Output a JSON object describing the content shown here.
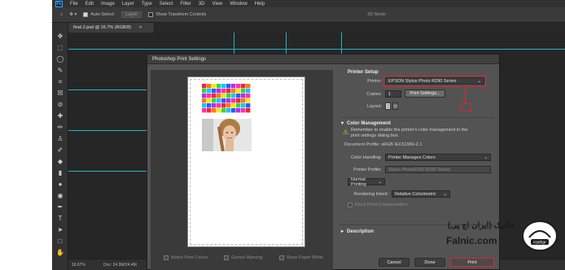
{
  "menubar": {
    "logo": "Ps",
    "items": [
      "File",
      "Edit",
      "Image",
      "Layer",
      "Type",
      "Select",
      "Filter",
      "3D",
      "View",
      "Window",
      "Help"
    ]
  },
  "optionsbar": {
    "auto_select_label": "Auto-Select:",
    "auto_select_value": "Layer",
    "show_transform_label": "Show Transform Controls",
    "mode_3d_label": "3D Mode:"
  },
  "document": {
    "tab_title": "final 2.psd @ 16.7% (RGB/8)",
    "tab_close": "×"
  },
  "statusbar": {
    "zoom": "16.67%",
    "doc_info": "Doc: 24.9M/24.4M"
  },
  "dialog": {
    "title": "Photoshop Print Settings",
    "preview_options": {
      "match_print_colors": "Match Print Colors",
      "gamut_warning": "Gamut Warning",
      "show_paper_white": "Show Paper White"
    },
    "printer_setup": {
      "title": "Printer Setup",
      "printer_label": "Printer:",
      "printer_value": "EPSON Stylus Photo R290 Series",
      "copies_label": "Copies:",
      "copies_value": "1",
      "print_settings_button": "Print Settings...",
      "layout_label": "Layout:"
    },
    "color_management": {
      "title": "Color Management",
      "warning_text": "Remember to enable the printer's color management in the print settings dialog box.",
      "document_profile": "Document Profile: sRGB IEC61966-2.1",
      "color_handling_label": "Color Handling:",
      "color_handling_value": "Printer Manages Colors",
      "printer_profile_label": "Printer Profile:",
      "printer_profile_value": "Stylus PhotoR260 R290 Series",
      "normal_printing_value": "Normal Printing",
      "rendering_intent_label": "Rendering Intent:",
      "rendering_intent_value": "Relative Colorimetric",
      "black_point_label": "Black Point Compensation"
    },
    "description": {
      "title": "Description"
    },
    "buttons": {
      "cancel": "Cancel",
      "done": "Done",
      "print": "Print"
    }
  },
  "watermark": {
    "brand_fa": "فالنیک (ایران اچ پی)",
    "url": "Falnic.com",
    "logo_text": "iranhpr"
  },
  "colors": {
    "accent_red": "#e3232a",
    "guide_cyan": "#1fb7c9",
    "ps_blue": "#31a8ff"
  },
  "icons": {
    "print_settings_info": "printer-icon",
    "layout_portrait": "portrait-layout-icon",
    "layout_landscape": "landscape-layout-icon",
    "warning": "warning-icon"
  }
}
